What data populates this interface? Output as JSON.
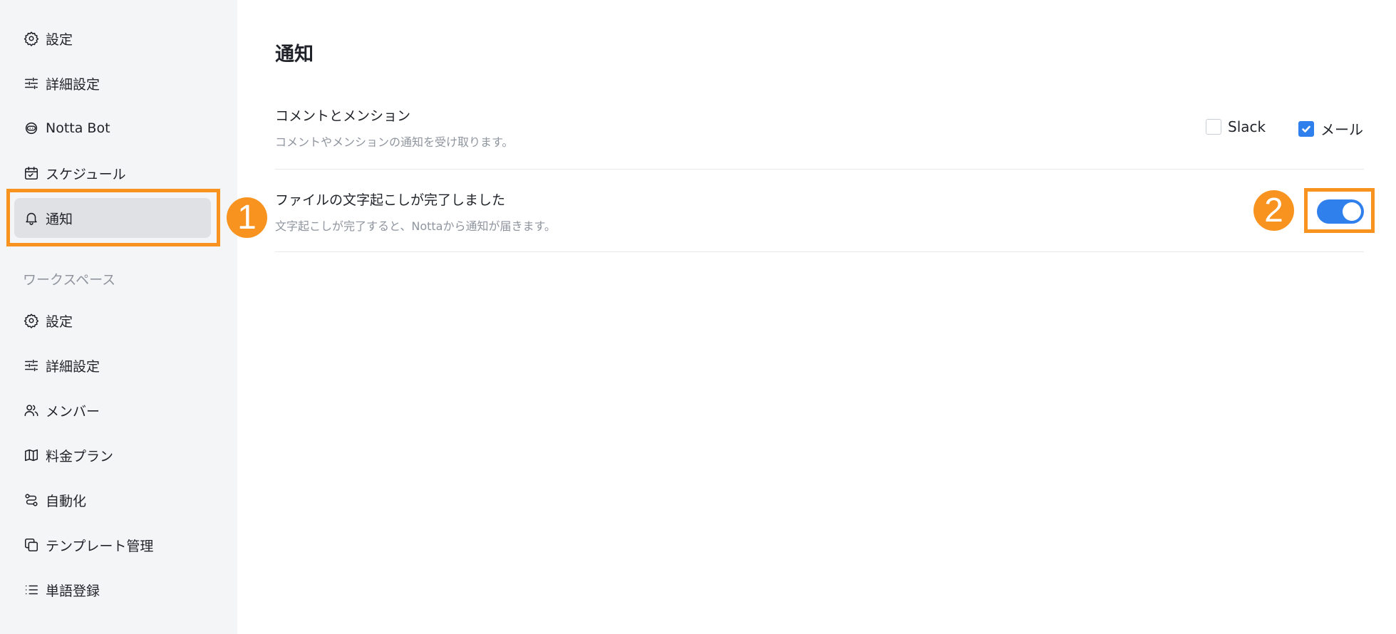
{
  "sidebar": {
    "items": [
      {
        "label": "設定",
        "icon": "gear-icon"
      },
      {
        "label": "詳細設定",
        "icon": "sliders-icon"
      },
      {
        "label": "Notta Bot",
        "icon": "bot-icon"
      },
      {
        "label": "スケジュール",
        "icon": "calendar-icon"
      },
      {
        "label": "通知",
        "icon": "bell-icon",
        "active": true
      }
    ],
    "workspace_label": "ワークスペース",
    "workspace_items": [
      {
        "label": "設定",
        "icon": "gear-icon"
      },
      {
        "label": "詳細設定",
        "icon": "sliders-icon"
      },
      {
        "label": "メンバー",
        "icon": "users-icon"
      },
      {
        "label": "料金プラン",
        "icon": "map-icon"
      },
      {
        "label": "自動化",
        "icon": "automation-icon"
      },
      {
        "label": "テンプレート管理",
        "icon": "template-icon"
      },
      {
        "label": "単語登録",
        "icon": "list-icon"
      }
    ]
  },
  "main": {
    "title": "通知",
    "settings": [
      {
        "title": "コメントとメンション",
        "description": "コメントやメンションの通知を受け取ります。",
        "options": [
          {
            "label": "Slack",
            "checked": false
          },
          {
            "label": "メール",
            "checked": true
          }
        ]
      },
      {
        "title": "ファイルの文字起こしが完了しました",
        "description": "文字起こしが完了すると、Nottaから通知が届きます。",
        "toggle_on": true
      }
    ]
  },
  "annotations": {
    "badge_1": "1",
    "badge_2": "2",
    "color": "#f7931e"
  },
  "colors": {
    "accent": "#2f80ed",
    "sidebar_bg": "#f4f5f7",
    "active_bg": "#dfe1e5"
  }
}
